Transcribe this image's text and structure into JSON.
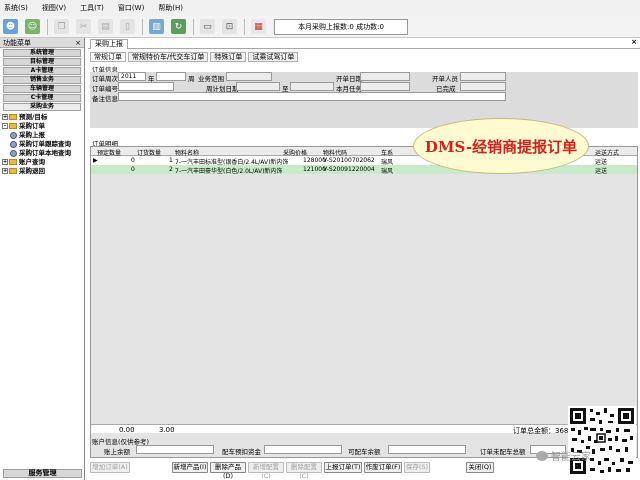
{
  "menu": [
    "系统(S)",
    "视图(V)",
    "工具(T)",
    "窗口(W)",
    "帮助(H)"
  ],
  "toolbar": {
    "notice": "本月采购上报数:0 成功数:0"
  },
  "left_panel": {
    "title": "功能菜单",
    "close": "×",
    "modules": [
      "系统管理",
      "目标管理",
      "A卡管理",
      "销售业务",
      "车辆管理",
      "C卡管理",
      "采购业务"
    ],
    "tree": [
      {
        "label": "预测/目标",
        "level": 0,
        "type": "folder",
        "pm": "+"
      },
      {
        "label": "采购订单",
        "level": 0,
        "type": "folder",
        "pm": "-"
      },
      {
        "label": "采购上报",
        "level": 1,
        "type": "leaf"
      },
      {
        "label": "采购订单跟踪查询",
        "level": 1,
        "type": "leaf"
      },
      {
        "label": "采购订单本地查询",
        "level": 1,
        "type": "leaf"
      },
      {
        "label": "账户查询",
        "level": 0,
        "type": "folder",
        "pm": "+"
      },
      {
        "label": "采购退回",
        "level": 0,
        "type": "folder",
        "pm": "+"
      }
    ],
    "footer": "服务管理"
  },
  "main": {
    "doc_tab": "采购上报",
    "close": "×",
    "sub_tabs": [
      "常规订单",
      "常规特价车/代交车订单",
      "特殊订单",
      "试乘试驾订单"
    ],
    "order_info_label": "订单信息",
    "header": {
      "order_week_label": "订单周次",
      "year": "2011",
      "year_label": "年",
      "week_label": "周",
      "biz_range_label": "业务范围",
      "open_date_label": "开单日期",
      "open_date_value": "",
      "open_person_label": "开单人员",
      "order_no_label": "订单编号",
      "plan_date_label": "周计划日期",
      "to_label": "至",
      "monthly_task_label": "本月任务",
      "completed_label": "已完成",
      "remark_label": "备注信息"
    },
    "detail_label": "订单明细",
    "columns": [
      "预定数量",
      "订货数量",
      "物料名称",
      "采购价格",
      "物料代码",
      "车系",
      "运送方式"
    ],
    "rows": [
      {
        "marker": "▶",
        "pre_qty": "0",
        "qty": "1",
        "material": "7-一汽丰田标准型(银香白/2.4L/AV)新内饰",
        "price": "128000",
        "code": "V-S20100702062",
        "series": "瑞风",
        "ship": "运送"
      },
      {
        "marker": "",
        "pre_qty": "0",
        "qty": "2",
        "material": "7-一汽丰田豪华型(白色/2.0L/AV)新内饰",
        "price": "121000",
        "code": "V-S20091220004",
        "series": "瑞风",
        "ship": "运送"
      }
    ],
    "footer_left": "0.00",
    "footer_mid": "3.00",
    "footer_total": "订单总金额：368400.00",
    "annotation": "DMS-经销商提报订单",
    "account_label": "账户信息(仅供参考)",
    "account": {
      "balance_label": "账上余额",
      "prepay_label": "配车预扣资金",
      "available_label": "可配车余额",
      "unshipped_label": "订单未配车总额"
    },
    "buttons": [
      {
        "label": "增加订单(A)",
        "enabled": false
      },
      {
        "label": "新增产品(I)",
        "enabled": true
      },
      {
        "label": "删除产品(D)",
        "enabled": true
      },
      {
        "label": "新增配置(C)",
        "enabled": false
      },
      {
        "label": "删除配置(C)",
        "enabled": false
      },
      {
        "label": "上报订单(T)",
        "enabled": true
      },
      {
        "label": "作废订单(F)",
        "enabled": true
      },
      {
        "label": "保存(S)",
        "enabled": false
      },
      {
        "label": "关闭(Q)",
        "enabled": true
      }
    ]
  },
  "watermark": "智能云家"
}
